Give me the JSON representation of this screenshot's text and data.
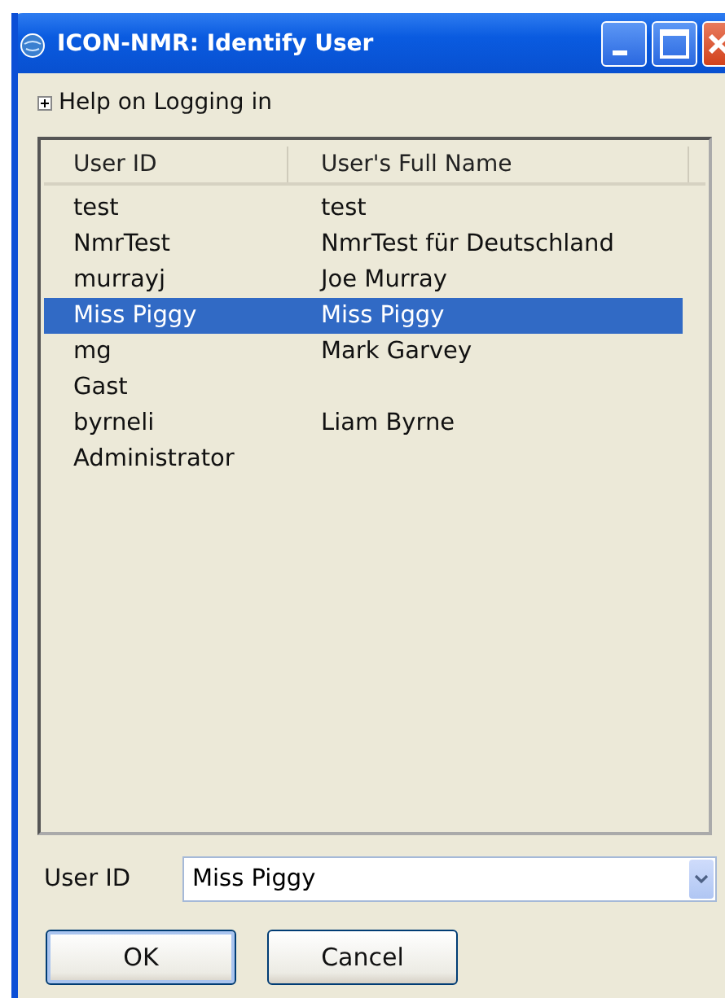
{
  "window": {
    "title": "ICON-NMR: Identify User"
  },
  "help": {
    "label": "Help on Logging in",
    "expanded": false
  },
  "table": {
    "columns": [
      "User ID",
      "User's Full Name"
    ],
    "rows": [
      {
        "id": "test",
        "name": "test",
        "selected": false
      },
      {
        "id": "NmrTest",
        "name": "NmrTest für Deutschland",
        "selected": false
      },
      {
        "id": "murrayj",
        "name": "Joe Murray",
        "selected": false
      },
      {
        "id": "Miss Piggy",
        "name": "Miss Piggy",
        "selected": true
      },
      {
        "id": "mg",
        "name": "Mark Garvey",
        "selected": false
      },
      {
        "id": "Gast",
        "name": "",
        "selected": false
      },
      {
        "id": "byrneli",
        "name": "Liam Byrne",
        "selected": false
      },
      {
        "id": "Administrator",
        "name": "",
        "selected": false
      }
    ]
  },
  "user_field": {
    "label": "User ID",
    "value": "Miss Piggy"
  },
  "buttons": [
    "OK",
    "Cancel"
  ]
}
